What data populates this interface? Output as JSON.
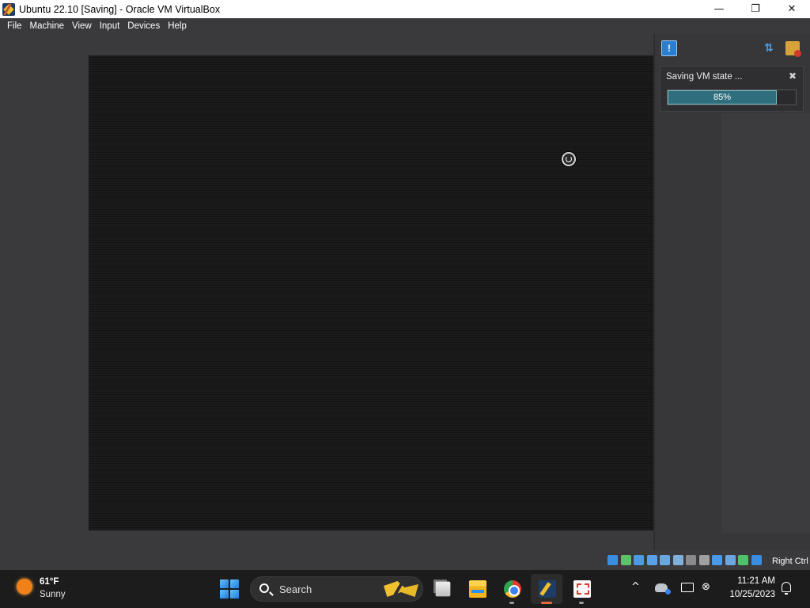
{
  "window": {
    "title": "Ubuntu 22.10 [Saving] - Oracle VM VirtualBox",
    "minimize": "—",
    "maximize": "❐",
    "close": "✕"
  },
  "menu": {
    "items": [
      "File",
      "Machine",
      "View",
      "Input",
      "Devices",
      "Help"
    ]
  },
  "notification": {
    "text": "Saving VM state ...",
    "close": "✖",
    "progress_label": "85%",
    "progress_percent": 85
  },
  "statusbar": {
    "host_key": "Right Ctrl",
    "icons": [
      {
        "name": "optical-drive-icon",
        "color": "#3b8de0"
      },
      {
        "name": "audio-icon",
        "color": "#5cc26a"
      },
      {
        "name": "network-icon",
        "color": "#4a9ae8"
      },
      {
        "name": "usb-icon",
        "color": "#5aa0e8"
      },
      {
        "name": "shared-folders-icon",
        "color": "#6aa6e0"
      },
      {
        "name": "drag-drop-icon",
        "color": "#7fb0dc"
      },
      {
        "name": "screen-capture-icon",
        "color": "#8a8a8a"
      },
      {
        "name": "video-capture-icon",
        "color": "#a0a0a0"
      },
      {
        "name": "display-icon",
        "color": "#4a9ae8"
      },
      {
        "name": "vt-x-icon",
        "color": "#6aa6e0"
      },
      {
        "name": "mouse-integration-icon",
        "color": "#4dc26a"
      },
      {
        "name": "keyboard-capture-icon",
        "color": "#3b8de0"
      }
    ]
  },
  "taskbar": {
    "weather_temp": "61°F",
    "weather_desc": "Sunny",
    "search_label": "Search",
    "time": "11:21 AM",
    "date": "10/25/2023",
    "chevron": "^",
    "network_icon": "⊗"
  }
}
